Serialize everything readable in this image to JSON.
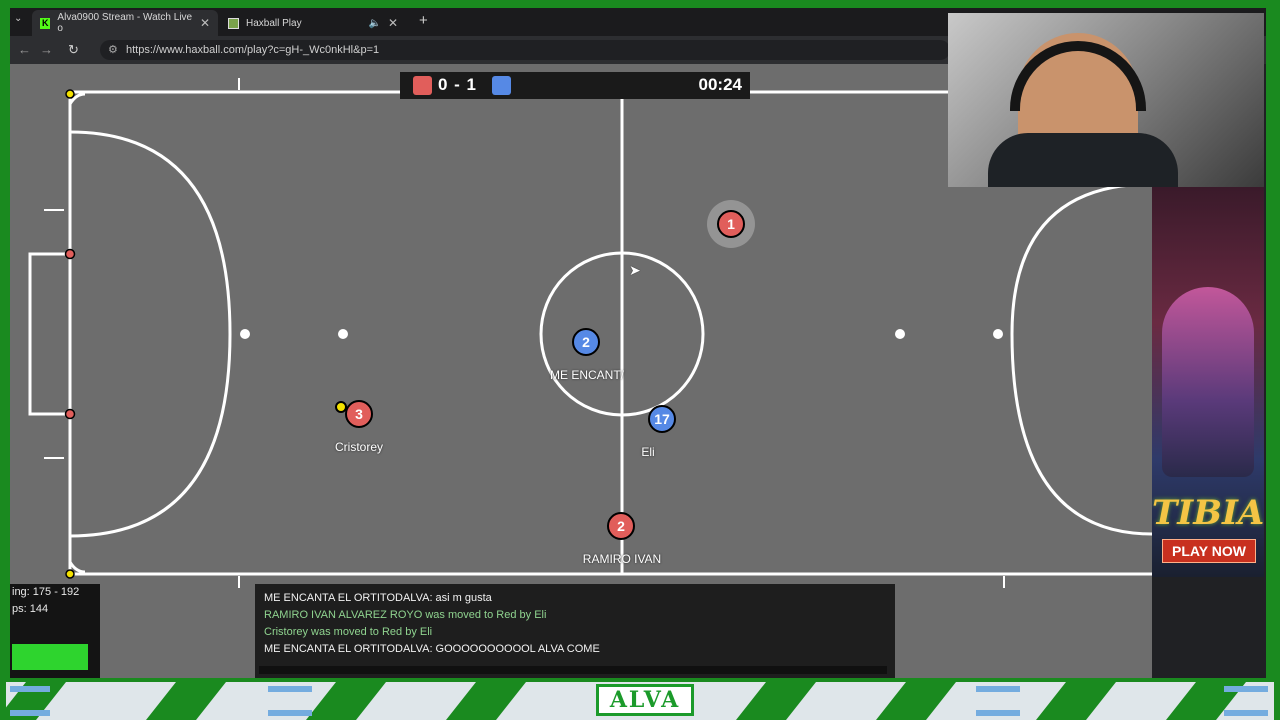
{
  "browser": {
    "tabs": [
      {
        "title": "Alva0900 Stream - Watch Live o",
        "icon": "kick-logo-icon"
      },
      {
        "title": "Haxball Play",
        "icon": "haxball-logo-icon"
      }
    ],
    "url": "https://www.haxball.com/play?c=gH-_Wc0nkHl&p=1"
  },
  "scoreboard": {
    "score": "0 - 1",
    "time": "00:24",
    "red_color": "#e15e5b",
    "blue_color": "#5689e5"
  },
  "players": [
    {
      "team": "red",
      "number": "1",
      "name": ""
    },
    {
      "team": "blue",
      "number": "2",
      "name": "ME ENCANT/"
    },
    {
      "team": "red",
      "number": "3",
      "name": "Cristorey"
    },
    {
      "team": "blue",
      "number": "17",
      "name": "Eli"
    },
    {
      "team": "red",
      "number": "2",
      "name": "RAMIRO IVAN"
    }
  ],
  "stats": {
    "ping": "ing: 175 - 192",
    "fps": "ps: 144"
  },
  "chat": {
    "messages": [
      {
        "text": "ME ENCANTA EL ORTITODALVA: asi m gusta",
        "style": "white"
      },
      {
        "text": "RAMIRO IVAN ALVAREZ ROYO was moved to Red by Eli",
        "style": "green"
      },
      {
        "text": "Cristorey was moved to Red by Eli",
        "style": "green"
      },
      {
        "text": "ME ENCANTA EL ORTITODALVA: GOOOOOOOOOOL ALVA COME",
        "style": "white"
      }
    ]
  },
  "ad": {
    "brand": "TIBIA",
    "button": "PLAY NOW"
  },
  "overlay": {
    "logo_text": "ALVA",
    "frame_color": "#1a8a1f"
  }
}
